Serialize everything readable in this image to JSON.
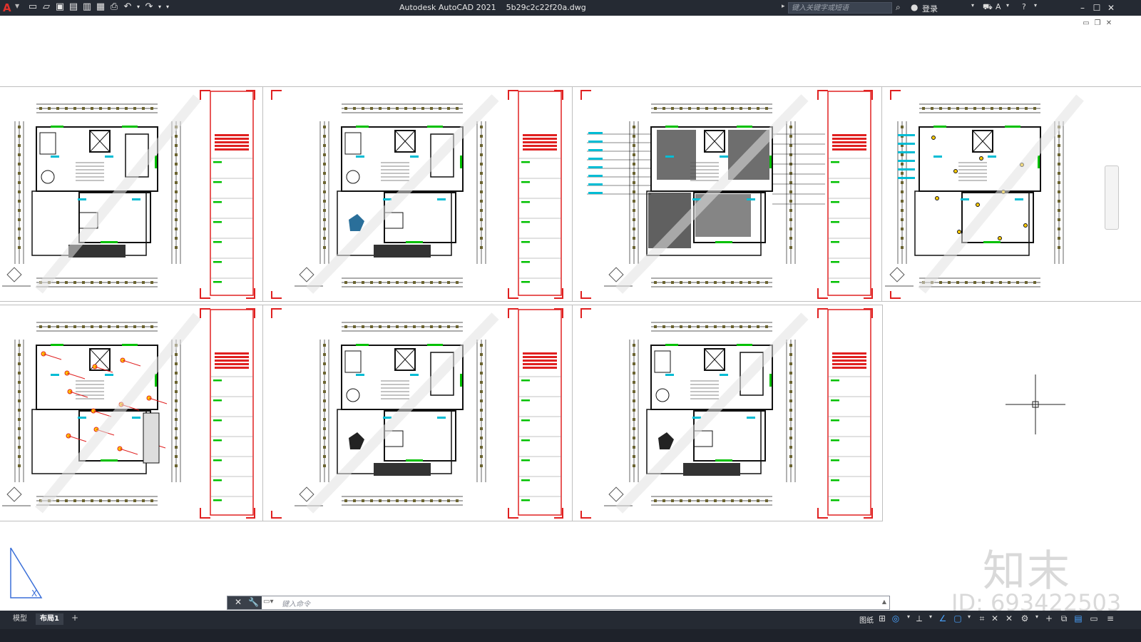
{
  "titlebar": {
    "app_title": "Autodesk AutoCAD 2021",
    "file_name": "5b29c2c22f20a.dwg",
    "search_placeholder": "键入关键字或短语",
    "login_label": "登录"
  },
  "command_line": {
    "placeholder": "键入命令"
  },
  "layout_tabs": [
    {
      "label": "模型",
      "active": false
    },
    {
      "label": "布局1",
      "active": true
    }
  ],
  "statusbar": {
    "paper_label": "图纸"
  },
  "watermark": {
    "logo_text": "知末",
    "id_text": "ID: 693422503"
  },
  "colors": {
    "titlebar_bg": "#252a33",
    "frame_red": "#e02020",
    "accent_green": "#00c000",
    "dimension_olive": "#6b6430",
    "cyan_text": "#00bcd4"
  },
  "icons": {
    "app_logo": "autocad-a-logo",
    "qat": [
      "new-icon",
      "open-icon",
      "save-icon",
      "save-as-icon",
      "plot-preview-icon",
      "publish-icon",
      "print-icon",
      "undo-icon",
      "redo-icon",
      "customize-icon"
    ],
    "titlebar_right": [
      "search-icon",
      "user-icon",
      "cart-icon",
      "autodesk-app-icon",
      "help-icon",
      "minimize-icon",
      "maximize-icon",
      "close-icon"
    ],
    "status": [
      "grid-icon",
      "snap-icon",
      "ortho-icon",
      "polar-icon",
      "osnap-icon",
      "otrack-icon",
      "lineweight-icon",
      "transparency-icon",
      "selection-cycle-icon",
      "annotation-icon",
      "workspace-gear-icon",
      "annotation-scale-icon",
      "units-icon",
      "quick-props-icon",
      "isolate-icon",
      "fullscreen-icon",
      "customize-menu-icon"
    ]
  }
}
